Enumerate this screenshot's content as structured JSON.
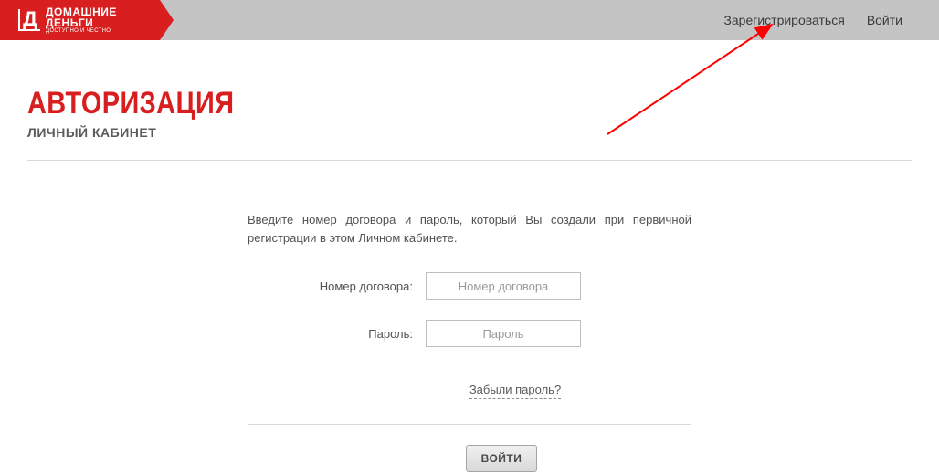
{
  "logo": {
    "line1": "ДОМАШНИЕ",
    "line2": "ДЕНЬГИ",
    "line3": "ДОСТУПНО И ЧЕСТНО"
  },
  "header": {
    "register": "Зарегистрироваться",
    "login": "Войти"
  },
  "page": {
    "title": "АВТОРИЗАЦИЯ",
    "subtitle": "ЛИЧНЫЙ КАБИНЕТ"
  },
  "form": {
    "instructions": "Введите номер договора и пароль, который Вы создали при первичной регистрации в этом Личном кабинете.",
    "contract_label": "Номер договора:",
    "contract_placeholder": "Номер договора",
    "password_label": "Пароль:",
    "password_placeholder": "Пароль",
    "forgot": "Забыли пароль?",
    "submit": "ВОЙТИ"
  }
}
